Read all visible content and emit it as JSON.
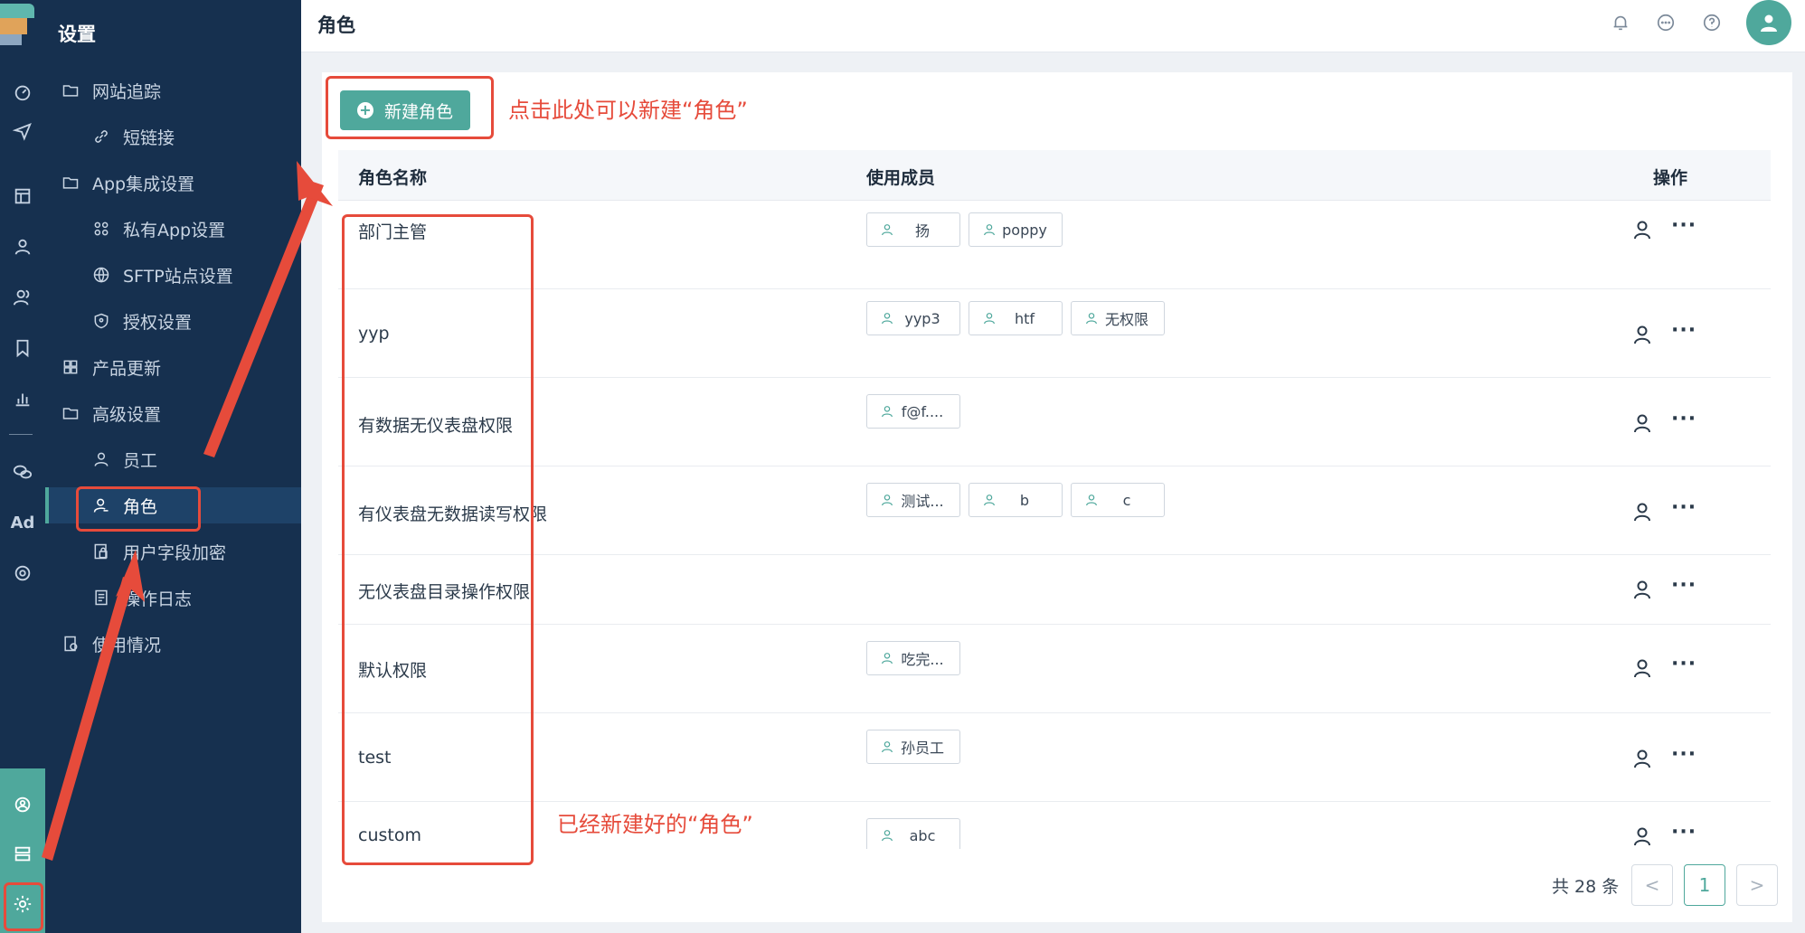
{
  "app": {
    "rail_icons": [
      "dashboard-icon",
      "send-icon",
      "layout-icon",
      "user-icon",
      "users-icon",
      "bookmark-icon",
      "bar-chart-icon",
      "wechat-icon",
      "ad-icon",
      "circle-progress-icon",
      "team-icon",
      "server-icon",
      "gear-icon"
    ],
    "rail_ad_label": "Ad"
  },
  "sidebar": {
    "title": "设置",
    "items": [
      {
        "label": "网站追踪",
        "icon": "folder-icon",
        "level": 1
      },
      {
        "label": "短链接",
        "icon": "link-icon",
        "level": 2
      },
      {
        "label": "App集成设置",
        "icon": "folder-icon",
        "level": 1
      },
      {
        "label": "私有App设置",
        "icon": "command-icon",
        "level": 2
      },
      {
        "label": "SFTP站点设置",
        "icon": "globe-icon",
        "level": 2
      },
      {
        "label": "授权设置",
        "icon": "shield-icon",
        "level": 2
      },
      {
        "label": "产品更新",
        "icon": "grid-icon",
        "level": 1
      },
      {
        "label": "高级设置",
        "icon": "folder-icon",
        "level": 1
      },
      {
        "label": "员工",
        "icon": "user-icon",
        "level": 2
      },
      {
        "label": "角色",
        "icon": "user-role-icon",
        "level": 2,
        "active": true
      },
      {
        "label": "用户字段加密",
        "icon": "encrypt-icon",
        "level": 2
      },
      {
        "label": "操作日志",
        "icon": "log-icon",
        "level": 2
      },
      {
        "label": "使用情况",
        "icon": "usage-icon",
        "level": 1
      }
    ]
  },
  "topbar": {
    "title": "角色",
    "icons": [
      "bell-icon",
      "chat-icon",
      "help-icon",
      "avatar"
    ]
  },
  "toolbar": {
    "new_role_label": "新建角色"
  },
  "annotations": {
    "new_role_hint": "点击此处可以新建“角色”",
    "created_roles_hint": "已经新建好的“角色”"
  },
  "table": {
    "columns": [
      "角色名称",
      "使用成员",
      "操作"
    ],
    "rows": [
      {
        "name": "部门主管",
        "members": [
          "扬",
          "poppy"
        ]
      },
      {
        "name": "yyp",
        "members": [
          "yyp3",
          "htf",
          "无权限"
        ]
      },
      {
        "name": "有数据无仪表盘权限",
        "members": [
          "f@f...."
        ]
      },
      {
        "name": "有仪表盘无数据读写权限",
        "members": [
          "测试...",
          "b",
          "c"
        ]
      },
      {
        "name": "无仪表盘目录操作权限",
        "members": []
      },
      {
        "name": "默认权限",
        "members": [
          "吃完..."
        ]
      },
      {
        "name": "test",
        "members": [
          "孙员工"
        ]
      },
      {
        "name": "custom",
        "members": [
          "abc"
        ]
      }
    ]
  },
  "pagination": {
    "total_label": "共 28 条",
    "prev": "<",
    "current": "1",
    "next": ">"
  },
  "colors": {
    "accent": "#4fa89c",
    "sidebar_bg": "#16304f",
    "annotation_red": "#e64b3b"
  }
}
